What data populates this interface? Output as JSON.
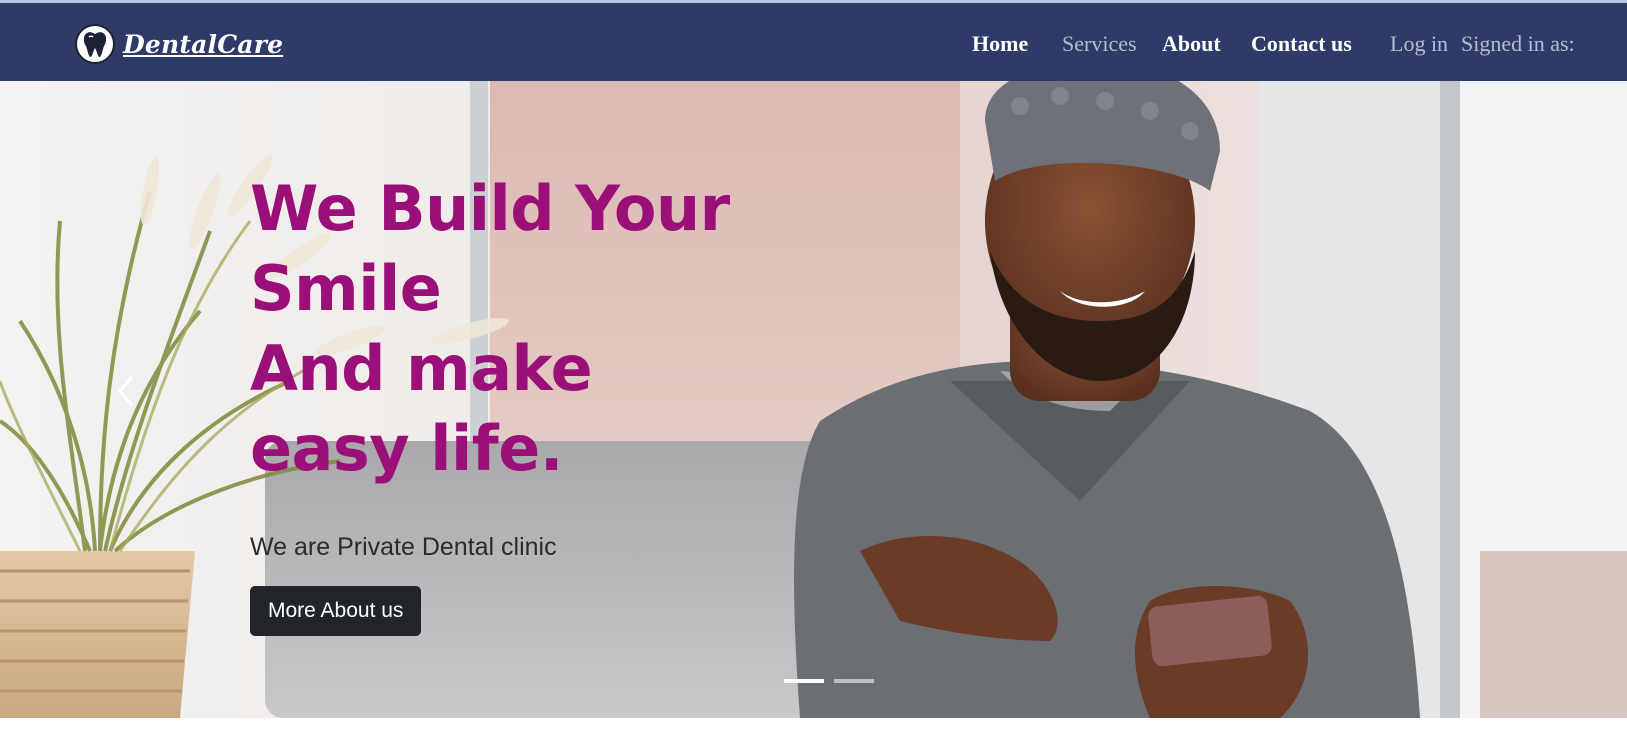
{
  "brand": {
    "name": "DentalCare",
    "logo_icon": "tooth-icon"
  },
  "nav": {
    "home": "Home",
    "services": "Services",
    "about": "About",
    "contact": "Contact us",
    "login": "Log in",
    "signed_in": "Signed in as:"
  },
  "hero": {
    "headline_lines": [
      "We Build Your",
      "Smile",
      "And make",
      "easy life."
    ],
    "subtitle": "We are Private Dental clinic",
    "cta_label": "More About us",
    "slides_total": 2,
    "active_slide": 1,
    "prev_icon": "chevron-left-icon"
  },
  "colors": {
    "navbar": "#2e3a68",
    "headline": "#9b0f78",
    "button": "#212529"
  }
}
